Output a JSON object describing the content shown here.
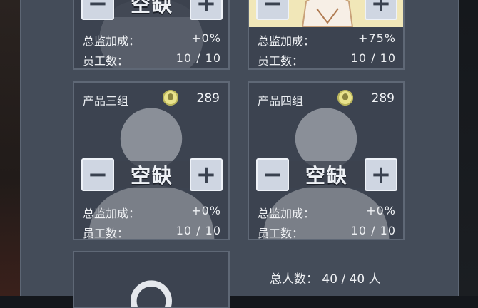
{
  "labels": {
    "director_bonus": "总监加成：",
    "staff_count": "员工数：",
    "vacant": "空缺",
    "minus": "−",
    "plus": "+"
  },
  "groups": [
    {
      "title": "",
      "count": "",
      "director_bonus": "+0%",
      "staff": "10 / 10",
      "vacant": true
    },
    {
      "title": "",
      "count": "",
      "director_bonus": "+75%",
      "staff": "10 / 10",
      "vacant": false
    },
    {
      "title": "产品三组",
      "count": "289",
      "director_bonus": "+0%",
      "staff": "10 / 10",
      "vacant": true
    },
    {
      "title": "产品四组",
      "count": "289",
      "director_bonus": "+0%",
      "staff": "10 / 10",
      "vacant": true
    }
  ],
  "summary": {
    "total_people_label": "总人数：",
    "total_people_value": "40 / 40 人"
  },
  "colors": {
    "panel": "#444c59",
    "card": "#3c4350",
    "bulb": "#e9e38c",
    "portrait_bg": "#f1e7b8"
  }
}
